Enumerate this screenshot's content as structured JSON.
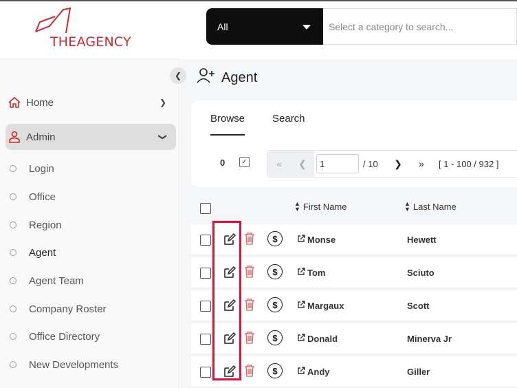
{
  "brand": {
    "logo_text": "THEAGENCY",
    "color": "#d9232d"
  },
  "sidebar": {
    "collapse_icon": "chevron-left-icon",
    "items": [
      {
        "label": "Home",
        "icon": "home-icon"
      },
      {
        "label": "Admin",
        "icon": "user-shield-icon"
      }
    ],
    "subitems": [
      "Login",
      "Office",
      "Region",
      "Agent",
      "Agent Team",
      "Company Roster",
      "Office Directory",
      "New Developments"
    ],
    "current": "Agent"
  },
  "search": {
    "category": "All",
    "placeholder": "Select a category to search..."
  },
  "page": {
    "title": "Agent",
    "tabs": [
      "Browse",
      "Search"
    ],
    "selected_count": "0",
    "pager": {
      "page": "1",
      "total": "/ 10",
      "range": "[ 1 - 100 / 932 ]"
    }
  },
  "table": {
    "columns": [
      "First Name",
      "Last Name"
    ],
    "rows": [
      {
        "first": "Monse",
        "last": "Hewett"
      },
      {
        "first": "Tom",
        "last": "Sciuto"
      },
      {
        "first": "Margaux",
        "last": "Scott"
      },
      {
        "first": "Donald",
        "last": "Minerva Jr"
      },
      {
        "first": "Andy",
        "last": "Giller"
      }
    ]
  },
  "colors": {
    "highlight": "#e0103a",
    "delete": "#e05a5a",
    "search_bg": "#0e0e0e"
  }
}
